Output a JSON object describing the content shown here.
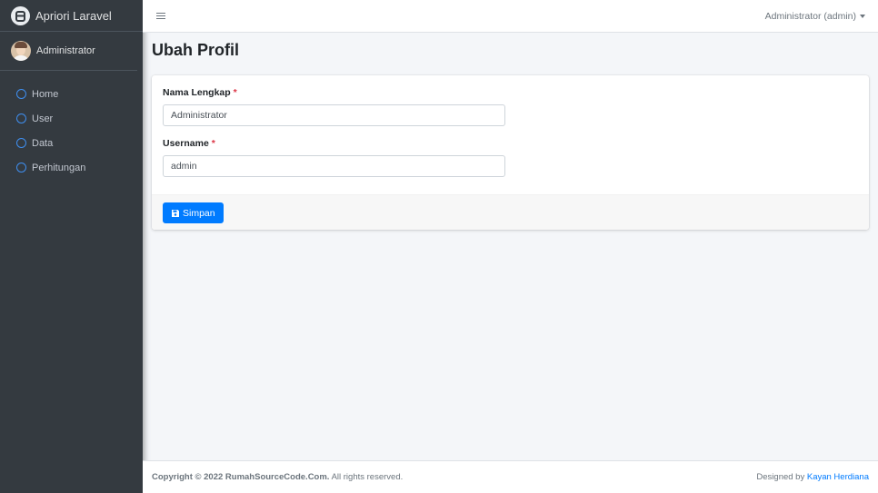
{
  "sidebar": {
    "brand": "Apriori Laravel",
    "user_name": "Administrator",
    "items": [
      {
        "label": "Home"
      },
      {
        "label": "User"
      },
      {
        "label": "Data"
      },
      {
        "label": "Perhitungan"
      }
    ]
  },
  "topbar": {
    "user_menu": "Administrator (admin)"
  },
  "page": {
    "title": "Ubah Profil"
  },
  "form": {
    "name_label": "Nama Lengkap",
    "name_value": "Administrator",
    "username_label": "Username",
    "username_value": "admin",
    "required_mark": "*",
    "save_label": "Simpan"
  },
  "footer": {
    "copyright_prefix": "Copyright © 2022 RumahSourceCode.Com.",
    "rights": " All rights reserved.",
    "designed_by": "Designed by ",
    "designer": "Kayan Herdiana"
  },
  "colors": {
    "accent": "#007bff",
    "sidebar_bg": "#343a40",
    "required": "#dc3545"
  }
}
